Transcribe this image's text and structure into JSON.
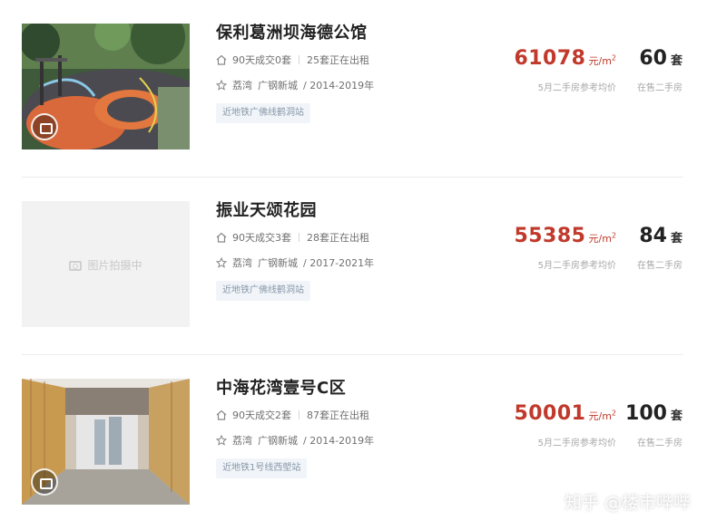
{
  "listings": [
    {
      "name": "保利葛洲坝海德公馆",
      "deals": "90天成交0套",
      "rent": "25套正在出租",
      "district": "荔湾",
      "area": "广钢新城",
      "years": "/ 2014-2019年",
      "tag": "近地铁广佛线鹤洞站",
      "price": "61078",
      "price_unit": "元/m",
      "price_unit_sup": "2",
      "price_label": "5月二手房参考均价",
      "count": "60",
      "count_unit": "套",
      "count_label": "在售二手房",
      "image": "playground-photo",
      "has_vr": true
    },
    {
      "name": "振业天颂花园",
      "deals": "90天成交3套",
      "rent": "28套正在出租",
      "district": "荔湾",
      "area": "广钢新城",
      "years": "/ 2017-2021年",
      "tag": "近地铁广佛线鹤洞站",
      "price": "55385",
      "price_unit": "元/m",
      "price_unit_sup": "2",
      "price_label": "5月二手房参考均价",
      "count": "84",
      "count_unit": "套",
      "count_label": "在售二手房",
      "image": "placeholder",
      "placeholder_text": "图片拍摄中",
      "has_vr": false
    },
    {
      "name": "中海花湾壹号C区",
      "deals": "90天成交2套",
      "rent": "87套正在出租",
      "district": "荔湾",
      "area": "广钢新城",
      "years": "/ 2014-2019年",
      "tag": "近地铁1号线西塱站",
      "price": "50001",
      "price_unit": "元/m",
      "price_unit_sup": "2",
      "price_label": "5月二手房参考均价",
      "count": "100",
      "count_unit": "套",
      "count_label": "在售二手房",
      "image": "corridor-photo",
      "has_vr": true
    }
  ],
  "icons": {
    "deals": "home-icon",
    "location": "star-icon",
    "vr": "vr-camera-icon",
    "camera": "camera-icon"
  },
  "colors": {
    "price": "#c0392b",
    "tag_bg": "#f1f5f9",
    "tag_text": "#8796a8"
  },
  "watermark": "知乎 @楼市哔哔"
}
